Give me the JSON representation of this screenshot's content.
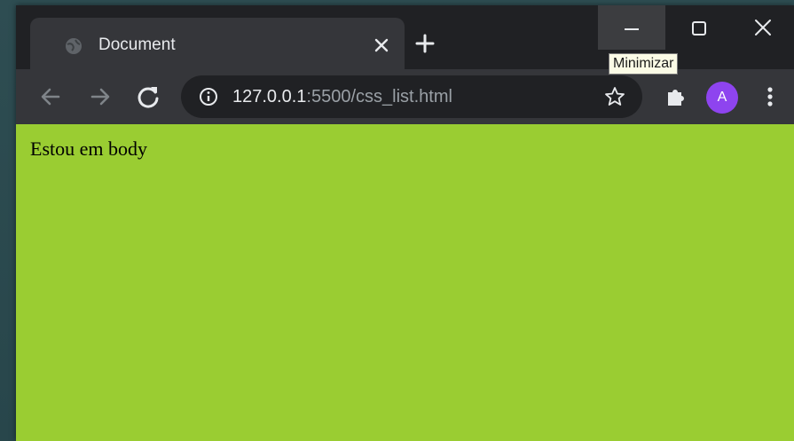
{
  "browser": {
    "tab": {
      "title": "Document",
      "favicon": "globe-icon",
      "close_icon": "close-icon"
    },
    "new_tab_icon": "plus-icon",
    "window_controls": {
      "minimize_tooltip": "Minimizar"
    },
    "toolbar": {
      "back_icon": "arrow-left-icon",
      "forward_icon": "arrow-right-icon",
      "reload_icon": "reload-icon",
      "url_host": "127.0.0.1",
      "url_rest": ":5500/css_list.html",
      "bookmark_icon": "star-icon",
      "extensions_icon": "puzzle-icon",
      "profile_initial": "A",
      "menu_icon": "kebab-menu-icon"
    }
  },
  "page": {
    "background": "#9acd32",
    "body_text": "Estou em body"
  },
  "colors": {
    "frame": "#202124",
    "toolbar": "#35363a",
    "avatar": "#8e44ef"
  }
}
